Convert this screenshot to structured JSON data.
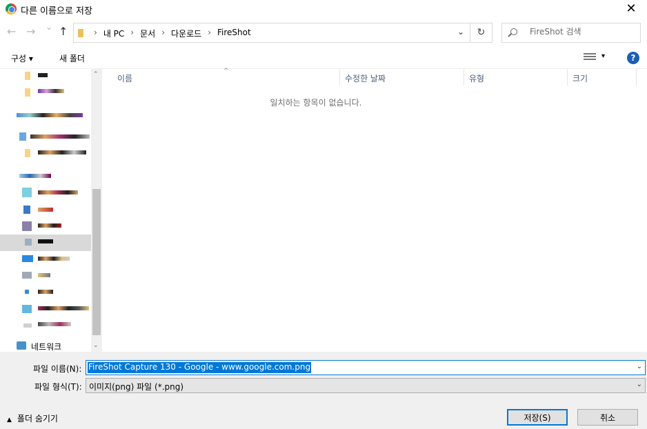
{
  "window": {
    "title": "다른 이름으로 저장",
    "close_label": "✕"
  },
  "nav": {
    "back": "←",
    "forward": "→",
    "recent": "⌄",
    "up": "↑",
    "breadcrumbs": [
      "내 PC",
      "문서",
      "다운로드",
      "FireShot"
    ],
    "dropdown": "⌄",
    "refresh": "↻",
    "search_placeholder": "FireShot 검색"
  },
  "toolbar": {
    "organize": "구성 ▾",
    "new_folder": "새 폴더",
    "view_drop": "▾",
    "help": "?"
  },
  "sidebar": {
    "network_label": "네트워크"
  },
  "columns": {
    "name": "이름",
    "modified": "수정한 날짜",
    "type": "유형",
    "size": "크기"
  },
  "empty_message": "일치하는 항목이 없습니다.",
  "form": {
    "filename_label": "파일 이름(N):",
    "filename_value": "FireShot Capture 130 - Google - www.google.com.png",
    "filetype_label": "파일 형식(T):",
    "filetype_value": "이미지(png) 파일 (*.png)"
  },
  "footer": {
    "hide_folders": "폴더 숨기기",
    "save": "저장(S)",
    "cancel": "취소"
  },
  "colors": {
    "accent": "#0078d7",
    "help": "#1a5fb4",
    "header_text": "#4c607a"
  }
}
